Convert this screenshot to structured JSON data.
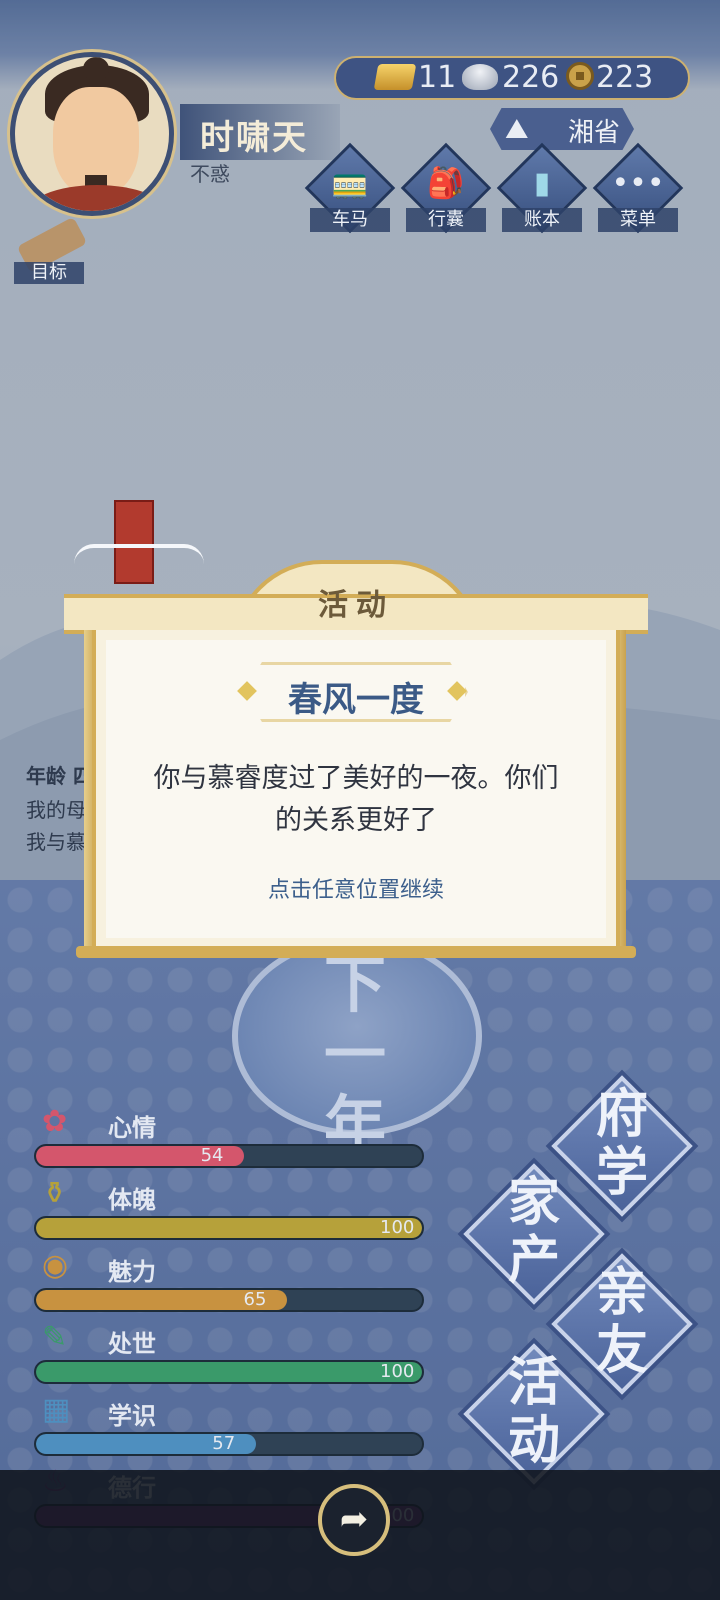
{
  "player": {
    "name": "时啸天",
    "age_title": "不惑"
  },
  "currency": {
    "gold": "11",
    "silver": "226",
    "coins": "223"
  },
  "location": "湘省",
  "top_menu": [
    {
      "label": "车马",
      "icon": "carriage-icon"
    },
    {
      "label": "行囊",
      "icon": "bag-icon"
    },
    {
      "label": "账本",
      "icon": "ledger-icon"
    },
    {
      "label": "菜单",
      "icon": "menu-dots-icon"
    }
  ],
  "goal_label": "目标",
  "log": {
    "year_line": "年龄 四",
    "line_a": "我的母",
    "line_b": "我与慕"
  },
  "next_year": "下一年",
  "stats": [
    {
      "name": "心情",
      "value": 54,
      "display": "54",
      "max": 100,
      "color": "#d4566c",
      "icon": "flower-icon"
    },
    {
      "name": "体魄",
      "value": 100,
      "display": "100",
      "max": 100,
      "color": "#b6a13a",
      "icon": "vase-icon"
    },
    {
      "name": "魅力",
      "value": 65,
      "display": "65",
      "max": 100,
      "color": "#c89240",
      "icon": "jade-icon"
    },
    {
      "name": "处世",
      "value": 100,
      "display": "100",
      "max": 100,
      "color": "#3a9a6a",
      "icon": "brush-icon"
    },
    {
      "name": "学识",
      "value": 57,
      "display": "57",
      "max": 100,
      "color": "#4e8fbf",
      "icon": "book-icon"
    },
    {
      "name": "德行",
      "value": 100,
      "display": "100",
      "max": 100,
      "color": "#7a3a8e",
      "icon": "censer-icon"
    }
  ],
  "big_menu": {
    "school": "府学",
    "property": "家产",
    "relatives": "亲友",
    "activity": "活动"
  },
  "popup": {
    "header": "活动",
    "event_title": "春风一度",
    "event_text_1": "你与慕睿度过了美好的一夜。你们",
    "event_text_2": "的关系更好了",
    "hint": "点击任意位置继续"
  },
  "colors": {
    "popup_border": "#d3ad57",
    "title_blue": "#3b5a86",
    "panel_blue": "#3e5383"
  }
}
